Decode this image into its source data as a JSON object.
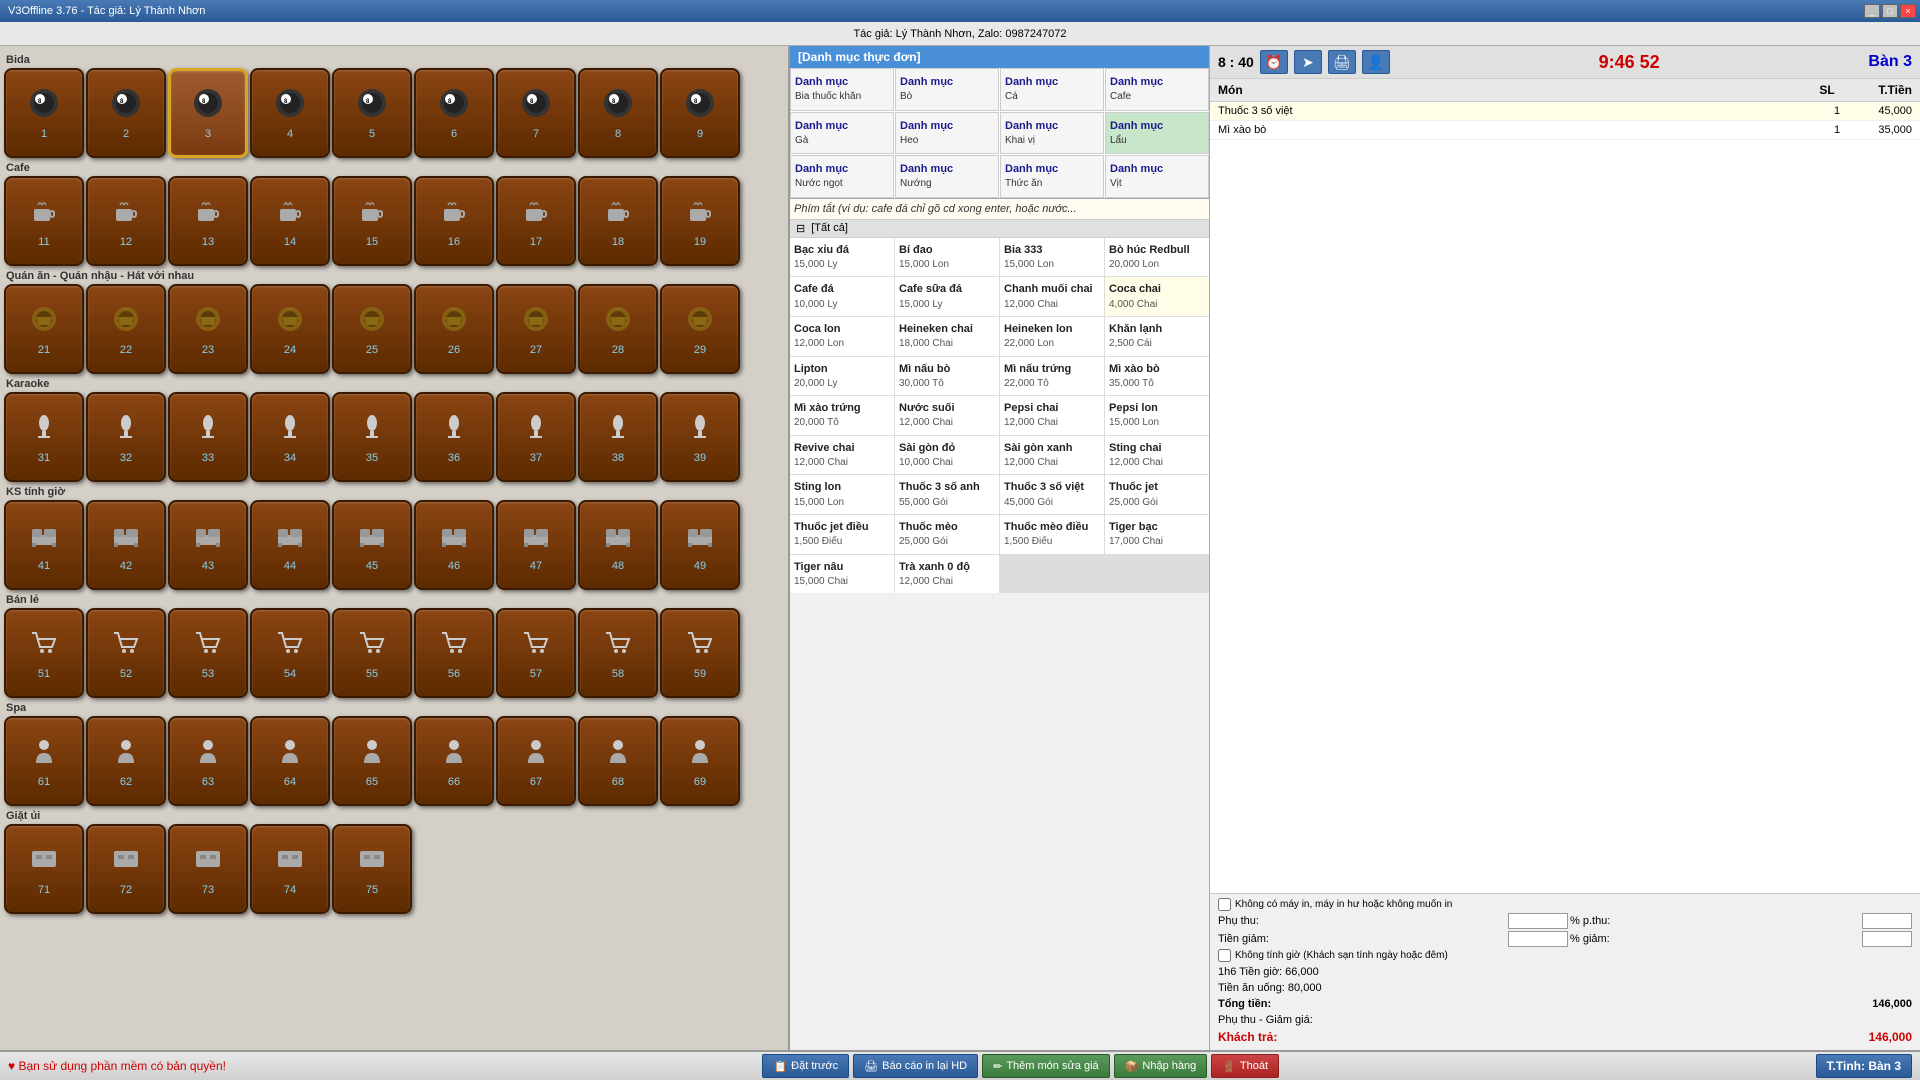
{
  "titlebar": {
    "title": "V3Offline 3.76 - Tác giả: Lý Thành Nhơn",
    "controls": [
      "_",
      "□",
      "×"
    ]
  },
  "infobar": {
    "text": "Tác giả: Lý Thành Nhơn, Zalo: 0987247072"
  },
  "clock": {
    "time": "8 : 40",
    "seconds": "9:46 52"
  },
  "current_table": "Bàn 3",
  "sections": [
    {
      "name": "Bida",
      "tables": [
        {
          "num": "1"
        },
        {
          "num": "2"
        },
        {
          "num": "3",
          "selected": true
        },
        {
          "num": "4"
        },
        {
          "num": "5"
        },
        {
          "num": "6"
        },
        {
          "num": "7"
        },
        {
          "num": "8"
        },
        {
          "num": "9"
        }
      ],
      "icon": "🎱"
    },
    {
      "name": "Cafe",
      "tables": [
        {
          "num": "11"
        },
        {
          "num": "12"
        },
        {
          "num": "13"
        },
        {
          "num": "14"
        },
        {
          "num": "15"
        },
        {
          "num": "16"
        },
        {
          "num": "17"
        },
        {
          "num": "18"
        },
        {
          "num": "19"
        }
      ],
      "icon": "☕"
    },
    {
      "name": "Quán ăn - Quán nhậu - Hát với nhau",
      "tables": [
        {
          "num": "21"
        },
        {
          "num": "22"
        },
        {
          "num": "23"
        },
        {
          "num": "24"
        },
        {
          "num": "25"
        },
        {
          "num": "26"
        },
        {
          "num": "27"
        },
        {
          "num": "28"
        },
        {
          "num": "29"
        }
      ],
      "icon": "🍺"
    },
    {
      "name": "Karaoke",
      "tables": [
        {
          "num": "31"
        },
        {
          "num": "32"
        },
        {
          "num": "33"
        },
        {
          "num": "34"
        },
        {
          "num": "35"
        },
        {
          "num": "36"
        },
        {
          "num": "37"
        },
        {
          "num": "38"
        },
        {
          "num": "39"
        }
      ],
      "icon": "🎤"
    },
    {
      "name": "KS tính giờ",
      "tables": [
        {
          "num": "41"
        },
        {
          "num": "42"
        },
        {
          "num": "43"
        },
        {
          "num": "44"
        },
        {
          "num": "45"
        },
        {
          "num": "46"
        },
        {
          "num": "47"
        },
        {
          "num": "48"
        },
        {
          "num": "49"
        }
      ],
      "icon": "🛏"
    },
    {
      "name": "Bán lẻ",
      "tables": [
        {
          "num": "51"
        },
        {
          "num": "52"
        },
        {
          "num": "53"
        },
        {
          "num": "54"
        },
        {
          "num": "55"
        },
        {
          "num": "56"
        },
        {
          "num": "57"
        },
        {
          "num": "58"
        },
        {
          "num": "59"
        }
      ],
      "icon": "🛒"
    },
    {
      "name": "Spa",
      "tables": [
        {
          "num": "61"
        },
        {
          "num": "62"
        },
        {
          "num": "63"
        },
        {
          "num": "64"
        },
        {
          "num": "65"
        },
        {
          "num": "66"
        },
        {
          "num": "67"
        },
        {
          "num": "68"
        },
        {
          "num": "69"
        }
      ],
      "icon": "💆"
    },
    {
      "name": "Giặt ủi",
      "tables": [
        {
          "num": "71"
        },
        {
          "num": "72"
        },
        {
          "num": "73"
        },
        {
          "num": "74"
        },
        {
          "num": "75"
        }
      ],
      "icon": "👕"
    }
  ],
  "menu_header": "[Danh mục thực đơn]",
  "categories": [
    {
      "name": "Danh mục",
      "sub": "Bia thuốc khăn"
    },
    {
      "name": "Danh mục",
      "sub": "Bò"
    },
    {
      "name": "Danh mục",
      "sub": "Cá"
    },
    {
      "name": "Danh mục",
      "sub": "Cafe"
    },
    {
      "name": "Danh mục",
      "sub": "Gà"
    },
    {
      "name": "Danh mục",
      "sub": "Heo"
    },
    {
      "name": "Danh mục",
      "sub": "Khai vị"
    },
    {
      "name": "Danh mục",
      "sub": "Lẩu",
      "active": true
    },
    {
      "name": "Danh mục",
      "sub": "Nước ngọt"
    },
    {
      "name": "Danh mục",
      "sub": "Nướng"
    },
    {
      "name": "Danh mục",
      "sub": "Thức ăn"
    },
    {
      "name": "Danh mục",
      "sub": "Vịt"
    }
  ],
  "shortcut_hint": "Phím tắt (ví dụ: cafe đá chỉ gõ cd xong enter, hoặc nước...",
  "items_header": "[Tất cả]",
  "items": [
    {
      "name": "Bạc xỉu đá",
      "price": "15,000 Ly"
    },
    {
      "name": "Bí đao",
      "price": "15,000 Lon"
    },
    {
      "name": "Bia 333",
      "price": "15,000 Lon"
    },
    {
      "name": "Bò húc Redbull",
      "price": "20,000 Lon"
    },
    {
      "name": "Cafe đá",
      "price": "10,000 Ly"
    },
    {
      "name": "Cafe sữa đá",
      "price": "15,000 Ly"
    },
    {
      "name": "Chanh muối chai",
      "price": "12,000 Chai"
    },
    {
      "name": "Coca chai",
      "price": "4,000 Chai",
      "highlight": true
    },
    {
      "name": "Coca lon",
      "price": "12,000 Lon"
    },
    {
      "name": "Heineken chai",
      "price": "18,000 Chai"
    },
    {
      "name": "Heineken lon",
      "price": "22,000 Lon"
    },
    {
      "name": "Khăn lạnh",
      "price": "2,500 Cái"
    },
    {
      "name": "Lipton",
      "price": "20,000 Ly"
    },
    {
      "name": "Mì nấu bò",
      "price": "30,000 Tô"
    },
    {
      "name": "Mì nấu trứng",
      "price": "22,000 Tô"
    },
    {
      "name": "Mì xào bò",
      "price": "35,000 Tô"
    },
    {
      "name": "Mì xào trứng",
      "price": "20,000 Tô"
    },
    {
      "name": "Nước suối",
      "price": "12,000 Chai"
    },
    {
      "name": "Pepsi chai",
      "price": "12,000 Chai"
    },
    {
      "name": "Pepsi lon",
      "price": "15,000 Lon"
    },
    {
      "name": "Revive chai",
      "price": "12,000 Chai"
    },
    {
      "name": "Sài gòn đỏ",
      "price": "10,000 Chai"
    },
    {
      "name": "Sài gòn xanh",
      "price": "12,000 Chai"
    },
    {
      "name": "Sting chai",
      "price": "12,000 Chai"
    },
    {
      "name": "Sting lon",
      "price": "15,000 Lon"
    },
    {
      "name": "Thuốc 3 số anh",
      "price": "55,000 Gói"
    },
    {
      "name": "Thuốc 3 số việt",
      "price": "45,000 Gói"
    },
    {
      "name": "Thuốc jet",
      "price": "25,000 Gói"
    },
    {
      "name": "Thuốc jet điều",
      "price": "1,500 Điếu"
    },
    {
      "name": "Thuốc mèo",
      "price": "25,000 Gói"
    },
    {
      "name": "Thuốc mèo điều",
      "price": "1,500 Điếu"
    },
    {
      "name": "Tiger bạc",
      "price": "17,000 Chai"
    },
    {
      "name": "Tiger nâu",
      "price": "15,000 Chai"
    },
    {
      "name": "Trà xanh 0 độ",
      "price": "12,000 Chai"
    }
  ],
  "order": {
    "headers": [
      "Món",
      "SL",
      "T.Tiền"
    ],
    "items": [
      {
        "name": "Thuốc 3 số việt",
        "qty": "1",
        "price": "45,000"
      },
      {
        "name": "Mì xào bò",
        "qty": "1",
        "price": "35,000"
      }
    ]
  },
  "options": {
    "no_printer": "Không có máy in, máy in hư hoặc không muốn in",
    "phu_thu_label": "Phụ thu:",
    "phu_thu_pct_label": "% p.thu:",
    "tien_giam_label": "Tiền giảm:",
    "tien_giam_pct_label": "% giảm:",
    "no_timer": "Không tính giờ (Khách sạn tính ngày hoặc đêm)"
  },
  "totals": {
    "gio_tien": "1h6 Tiền giờ: 66,000",
    "tien_an_uong": "Tiền ăn uống: 80,000",
    "tong_tien_label": "Tổng tiền:",
    "tong_tien": "146,000",
    "phu_thu_giam_label": "Phụ thu - Giảm giá:",
    "phu_thu_giam": "",
    "khach_tra_label": "Khách trả:",
    "khach_tra": "146,000"
  },
  "bottombar": {
    "love_text": "♥ Bạn sử dụng phần mềm có bản quyền!",
    "buttons": [
      {
        "label": "Đặt trước",
        "icon": "📋"
      },
      {
        "label": "Báo cáo in lại HD",
        "icon": "🖨"
      },
      {
        "label": "Thêm món sửa giá",
        "icon": "✏"
      },
      {
        "label": "Nhập hàng",
        "icon": "📦"
      },
      {
        "label": "Thoát",
        "icon": "🚪"
      }
    ],
    "ttinh": "T.Tinh: Bàn 3"
  }
}
